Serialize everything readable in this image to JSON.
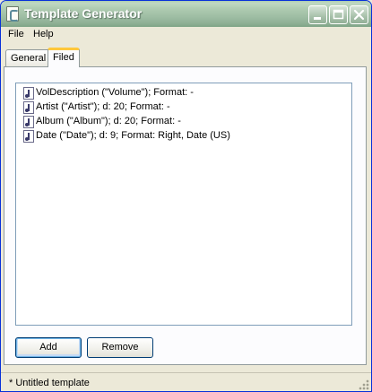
{
  "window": {
    "title": "Template Generator",
    "controls": {
      "minimize": "minimize-icon",
      "maximize": "maximize-icon",
      "close": "close-icon"
    }
  },
  "menu": {
    "items": [
      {
        "label": "File"
      },
      {
        "label": "Help"
      }
    ]
  },
  "tabs": [
    {
      "label": "General",
      "active": false
    },
    {
      "label": "Filed",
      "active": true
    }
  ],
  "fields": {
    "items": [
      {
        "label": "VolDescription (\"Volume\"); Format: -",
        "icon": "music-file-icon"
      },
      {
        "label": "Artist (\"Artist\"); d: 20; Format: -",
        "icon": "music-file-icon"
      },
      {
        "label": "Album (\"Album\"); d: 20; Format: -",
        "icon": "music-file-icon"
      },
      {
        "label": "Date (\"Date\"); d: 9; Format: Right, Date (US)",
        "icon": "music-file-icon"
      }
    ]
  },
  "buttons": {
    "add": "Add",
    "remove": "Remove"
  },
  "status": {
    "text": "*  Untitled template"
  },
  "colors": {
    "titlebar": "#a8c8ad",
    "tab_active_accent": "#ffc83c",
    "panel": "#fcfcfe",
    "chrome": "#ece9d8"
  }
}
